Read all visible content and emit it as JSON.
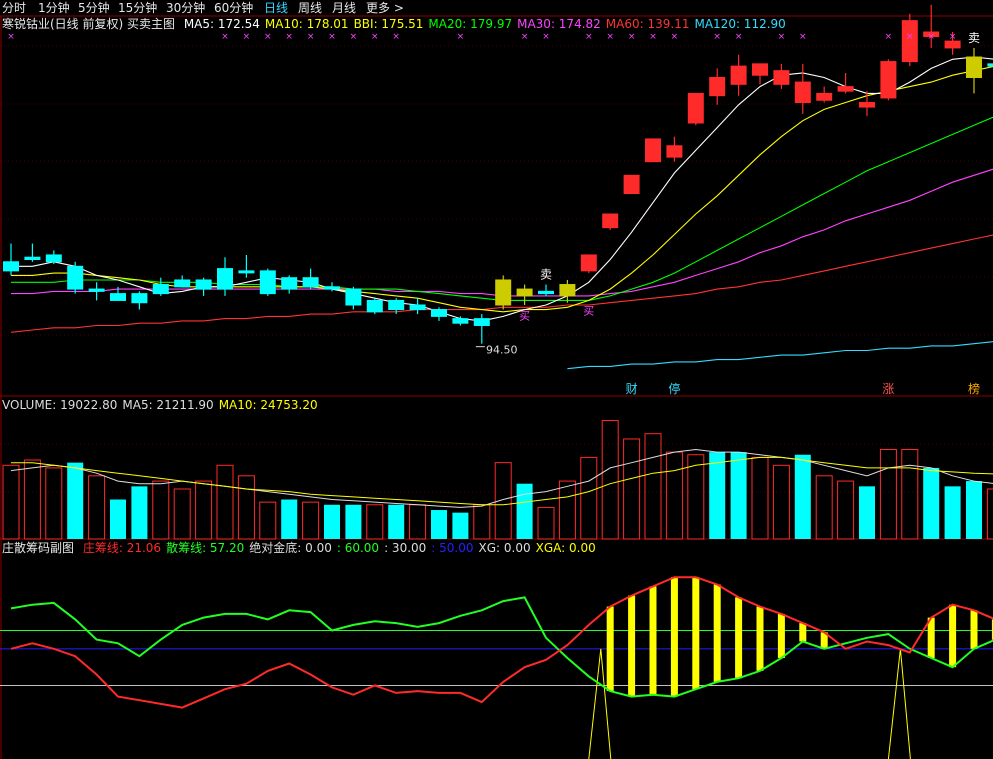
{
  "period_tabs": [
    {
      "label": "分时",
      "active": false
    },
    {
      "label": "1分钟",
      "active": false
    },
    {
      "label": "5分钟",
      "active": false
    },
    {
      "label": "15分钟",
      "active": false
    },
    {
      "label": "30分钟",
      "active": false
    },
    {
      "label": "60分钟",
      "active": false
    },
    {
      "label": "日线",
      "active": true
    },
    {
      "label": "周线",
      "active": false
    },
    {
      "label": "月线",
      "active": false
    },
    {
      "label": "更多 >",
      "active": false
    }
  ],
  "main_legend": {
    "title": "寒锐钴业(日线 前复权) 买卖主图",
    "items": [
      {
        "text": "MA5: 172.54",
        "color": "#ffffff"
      },
      {
        "text": "MA10: 178.01",
        "color": "#ffff00"
      },
      {
        "text": "BBI: 175.51",
        "color": "#ffff00"
      },
      {
        "text": "MA20: 179.97",
        "color": "#00ff00"
      },
      {
        "text": "MA30: 174.82",
        "color": "#ff44ff"
      },
      {
        "text": "MA60: 139.11",
        "color": "#ff3333"
      },
      {
        "text": "MA120: 112.90",
        "color": "#33ddff"
      }
    ]
  },
  "volume_legend": {
    "items": [
      {
        "text": "VOLUME: 19022.80",
        "color": "#dddddd"
      },
      {
        "text": "MA5: 21211.90",
        "color": "#dddddd"
      },
      {
        "text": "MA10: 24753.20",
        "color": "#ffff00"
      }
    ]
  },
  "sub_legend": {
    "title": "庄散筹码副图",
    "items": [
      {
        "text": "庄筹线: 21.06",
        "color": "#ff2a2a"
      },
      {
        "text": "散筹线: 57.20",
        "color": "#22ff22"
      },
      {
        "text": "绝对金底: 0.00",
        "color": "#dddddd"
      },
      {
        "text": ": 60.00",
        "color": "#22ff22"
      },
      {
        "text": ": 30.00",
        "color": "#dddddd"
      },
      {
        "text": ": 50.00",
        "color": "#2222ff"
      },
      {
        "text": "XG: 0.00",
        "color": "#dddddd"
      },
      {
        "text": "XGA: 0.00",
        "color": "#ffff00"
      }
    ]
  },
  "annotations": {
    "low_price": "94.50",
    "sell1": "卖",
    "buy1": "买",
    "buy2": "买",
    "sell2": "卖",
    "event_cai": "财",
    "event_ting": "停",
    "event_zhang": "涨",
    "event_bang": "榜"
  },
  "colors": {
    "up": "#ff2a2a",
    "down": "#00ffff",
    "signal": "#cccc00",
    "ma5": "#ffffff",
    "ma10": "#ffff00",
    "ma20": "#00ff00",
    "ma30": "#ff44ff",
    "ma60": "#ff3333",
    "ma120": "#33ddff",
    "grid": "#8b0000"
  },
  "chart_data": [
    {
      "type": "candlestick",
      "price_range": [
        80,
        240
      ],
      "candles": [
        {
          "o": 139,
          "h": 147,
          "l": 133,
          "c": 135,
          "color": "down"
        },
        {
          "o": 141,
          "h": 147,
          "l": 139,
          "c": 140,
          "color": "down"
        },
        {
          "o": 142,
          "h": 144,
          "l": 138,
          "c": 139,
          "color": "down"
        },
        {
          "o": 137,
          "h": 139,
          "l": 125,
          "c": 127,
          "color": "down"
        },
        {
          "o": 127,
          "h": 130,
          "l": 122,
          "c": 126,
          "color": "down"
        },
        {
          "o": 125,
          "h": 128,
          "l": 122,
          "c": 122,
          "color": "down"
        },
        {
          "o": 125,
          "h": 126,
          "l": 118,
          "c": 121,
          "color": "down"
        },
        {
          "o": 129,
          "h": 132,
          "l": 124,
          "c": 125,
          "color": "down"
        },
        {
          "o": 131,
          "h": 133,
          "l": 128,
          "c": 128,
          "color": "down"
        },
        {
          "o": 127,
          "h": 132,
          "l": 124,
          "c": 131,
          "color": "down"
        },
        {
          "o": 136,
          "h": 141,
          "l": 124,
          "c": 127,
          "color": "down"
        },
        {
          "o": 135,
          "h": 142,
          "l": 132,
          "c": 135,
          "color": "down"
        },
        {
          "o": 135,
          "h": 136,
          "l": 124,
          "c": 125,
          "color": "down"
        },
        {
          "o": 132,
          "h": 133,
          "l": 125,
          "c": 127,
          "color": "down"
        },
        {
          "o": 132,
          "h": 136,
          "l": 127,
          "c": 128,
          "color": "down"
        },
        {
          "o": 128,
          "h": 130,
          "l": 126,
          "c": 127,
          "color": "down"
        },
        {
          "o": 127,
          "h": 128,
          "l": 118,
          "c": 120,
          "color": "down"
        },
        {
          "o": 122,
          "h": 123,
          "l": 116,
          "c": 117,
          "color": "down"
        },
        {
          "o": 122,
          "h": 123,
          "l": 116,
          "c": 118,
          "color": "down"
        },
        {
          "o": 120,
          "h": 123,
          "l": 116,
          "c": 118,
          "color": "down"
        },
        {
          "o": 118,
          "h": 119,
          "l": 113,
          "c": 115,
          "color": "down"
        },
        {
          "o": 114,
          "h": 115,
          "l": 111,
          "c": 112,
          "color": "down"
        },
        {
          "o": 114,
          "h": 116,
          "l": 103,
          "c": 111,
          "color": "down"
        },
        {
          "o": 120,
          "h": 133,
          "l": 118,
          "c": 131,
          "color": "signal"
        },
        {
          "o": 127,
          "h": 129,
          "l": 120,
          "c": 124,
          "color": "signal"
        },
        {
          "o": 126,
          "h": 129,
          "l": 124,
          "c": 125,
          "color": "down"
        },
        {
          "o": 124,
          "h": 131,
          "l": 121,
          "c": 129,
          "color": "signal"
        },
        {
          "o": 135,
          "h": 142,
          "l": 134,
          "c": 142,
          "color": "up"
        },
        {
          "o": 154,
          "h": 160,
          "l": 153,
          "c": 160,
          "color": "up"
        },
        {
          "o": 169,
          "h": 177,
          "l": 169,
          "c": 177,
          "color": "up"
        },
        {
          "o": 183,
          "h": 193,
          "l": 183,
          "c": 193,
          "color": "up"
        },
        {
          "o": 190,
          "h": 194,
          "l": 183,
          "c": 185,
          "color": "up"
        },
        {
          "o": 200,
          "h": 213,
          "l": 199,
          "c": 213,
          "color": "up"
        },
        {
          "o": 212,
          "h": 224,
          "l": 208,
          "c": 220,
          "color": "up"
        },
        {
          "o": 217,
          "h": 230,
          "l": 212,
          "c": 225,
          "color": "up"
        },
        {
          "o": 226,
          "h": 226,
          "l": 217,
          "c": 221,
          "color": "up"
        },
        {
          "o": 223,
          "h": 226,
          "l": 215,
          "c": 217,
          "color": "up"
        },
        {
          "o": 218,
          "h": 226,
          "l": 204,
          "c": 209,
          "color": "up"
        },
        {
          "o": 213,
          "h": 216,
          "l": 209,
          "c": 210,
          "color": "up"
        },
        {
          "o": 216,
          "h": 222,
          "l": 213,
          "c": 214,
          "color": "up"
        },
        {
          "o": 209,
          "h": 214,
          "l": 203,
          "c": 207,
          "color": "up"
        },
        {
          "o": 211,
          "h": 228,
          "l": 210,
          "c": 227,
          "color": "up"
        },
        {
          "o": 245,
          "h": 248,
          "l": 225,
          "c": 227,
          "color": "up"
        },
        {
          "o": 240,
          "h": 252,
          "l": 233,
          "c": 238,
          "color": "up"
        },
        {
          "o": 233,
          "h": 240,
          "l": 230,
          "c": 236,
          "color": "up"
        },
        {
          "o": 220,
          "h": 233,
          "l": 213,
          "c": 229,
          "color": "signal"
        },
        {
          "o": 226,
          "h": 228,
          "l": 223,
          "c": 225,
          "color": "down"
        }
      ],
      "ma5": [
        137,
        137,
        139,
        137,
        133,
        131,
        128,
        125,
        126,
        128,
        128,
        130,
        132,
        131,
        130,
        127,
        125,
        123,
        121,
        120,
        117,
        114,
        113,
        115,
        118,
        120,
        124,
        130,
        140,
        152,
        165,
        178,
        188,
        198,
        208,
        216,
        221,
        222,
        220,
        216,
        213,
        213,
        218,
        224,
        228,
        229,
        228
      ],
      "ma10": [
        133,
        133,
        134,
        134,
        133,
        132,
        131,
        129,
        128,
        128,
        128,
        128,
        128,
        128,
        128,
        127,
        126,
        125,
        124,
        123,
        121,
        119,
        118,
        117,
        118,
        118,
        119,
        122,
        127,
        134,
        142,
        151,
        160,
        168,
        177,
        186,
        194,
        201,
        206,
        209,
        212,
        214,
        216,
        218,
        221,
        223,
        225
      ],
      "ma20": [
        130,
        130,
        130,
        131,
        131,
        131,
        131,
        130,
        130,
        130,
        129,
        129,
        129,
        128,
        128,
        128,
        127,
        127,
        127,
        126,
        125,
        124,
        123,
        122,
        122,
        122,
        122,
        122,
        124,
        127,
        130,
        134,
        139,
        144,
        149,
        154,
        159,
        164,
        169,
        174,
        179,
        183,
        187,
        191,
        195,
        199,
        203
      ],
      "ma30": [
        125,
        125,
        126,
        126,
        126,
        127,
        127,
        127,
        127,
        127,
        127,
        127,
        127,
        127,
        127,
        127,
        127,
        127,
        126,
        126,
        126,
        125,
        125,
        124,
        124,
        124,
        124,
        124,
        125,
        126,
        128,
        130,
        133,
        136,
        139,
        143,
        146,
        150,
        153,
        157,
        160,
        163,
        166,
        170,
        174,
        177,
        180
      ],
      "ma60": [
        108,
        109,
        110,
        110,
        111,
        111,
        112,
        112,
        113,
        113,
        114,
        114,
        115,
        115,
        116,
        116,
        117,
        117,
        117,
        118,
        118,
        118,
        118,
        119,
        119,
        119,
        120,
        120,
        121,
        122,
        123,
        124,
        125,
        127,
        128,
        130,
        131,
        133,
        135,
        137,
        139,
        141,
        143,
        145,
        147,
        149,
        151
      ],
      "ma120_start_index": 26,
      "ma120": [
        92,
        93,
        93,
        94,
        94,
        95,
        95,
        96,
        96,
        97,
        98,
        98,
        99,
        100,
        100,
        101,
        101,
        102,
        102,
        103,
        104
      ],
      "price_labels": {
        "low": 94.5
      }
    },
    {
      "type": "bar",
      "title": "VOLUME",
      "range": [
        0,
        49000
      ],
      "values": [
        {
          "v": 28000,
          "color": "up"
        },
        {
          "v": 30000,
          "color": "up"
        },
        {
          "v": 27000,
          "color": "up"
        },
        {
          "v": 29000,
          "color": "down"
        },
        {
          "v": 24000,
          "color": "up"
        },
        {
          "v": 15000,
          "color": "down"
        },
        {
          "v": 20000,
          "color": "down"
        },
        {
          "v": 22000,
          "color": "up"
        },
        {
          "v": 19000,
          "color": "up"
        },
        {
          "v": 22000,
          "color": "up"
        },
        {
          "v": 28000,
          "color": "up"
        },
        {
          "v": 24000,
          "color": "up"
        },
        {
          "v": 14000,
          "color": "up"
        },
        {
          "v": 15000,
          "color": "down"
        },
        {
          "v": 14000,
          "color": "up"
        },
        {
          "v": 13000,
          "color": "down"
        },
        {
          "v": 13000,
          "color": "down"
        },
        {
          "v": 13000,
          "color": "up"
        },
        {
          "v": 13000,
          "color": "down"
        },
        {
          "v": 13000,
          "color": "up"
        },
        {
          "v": 11000,
          "color": "down"
        },
        {
          "v": 10000,
          "color": "down"
        },
        {
          "v": 13000,
          "color": "up"
        },
        {
          "v": 29000,
          "color": "up"
        },
        {
          "v": 21000,
          "color": "down"
        },
        {
          "v": 12000,
          "color": "up"
        },
        {
          "v": 22000,
          "color": "up"
        },
        {
          "v": 31000,
          "color": "up"
        },
        {
          "v": 45000,
          "color": "up"
        },
        {
          "v": 38000,
          "color": "up"
        },
        {
          "v": 40000,
          "color": "up"
        },
        {
          "v": 33000,
          "color": "up"
        },
        {
          "v": 32000,
          "color": "up"
        },
        {
          "v": 33000,
          "color": "down"
        },
        {
          "v": 33000,
          "color": "down"
        },
        {
          "v": 31000,
          "color": "up"
        },
        {
          "v": 28000,
          "color": "up"
        },
        {
          "v": 32000,
          "color": "down"
        },
        {
          "v": 24000,
          "color": "up"
        },
        {
          "v": 22000,
          "color": "up"
        },
        {
          "v": 20000,
          "color": "down"
        },
        {
          "v": 34000,
          "color": "up"
        },
        {
          "v": 34000,
          "color": "up"
        },
        {
          "v": 27000,
          "color": "down"
        },
        {
          "v": 20000,
          "color": "down"
        },
        {
          "v": 22000,
          "color": "down"
        },
        {
          "v": 19000,
          "color": "up"
        }
      ],
      "ma5": [
        26000,
        27000,
        28000,
        27000,
        25000,
        22000,
        21000,
        21000,
        22000,
        21000,
        20000,
        19000,
        18000,
        17000,
        16000,
        15000,
        14500,
        14000,
        13500,
        13000,
        12500,
        12000,
        12500,
        15000,
        17000,
        18000,
        20000,
        22000,
        27000,
        29000,
        31000,
        33000,
        34000,
        33000,
        33000,
        32000,
        31000,
        30000,
        28000,
        26000,
        24000,
        27000,
        28000,
        27000,
        24000,
        22000,
        21000
      ],
      "ma10": [
        29000,
        29000,
        28000,
        27000,
        26000,
        25000,
        24000,
        23000,
        22000,
        21000,
        20000,
        19000,
        18500,
        18000,
        17000,
        16500,
        16000,
        15500,
        15000,
        14500,
        14000,
        13500,
        13000,
        13000,
        14000,
        15000,
        16000,
        18000,
        21000,
        23000,
        25000,
        26000,
        28000,
        29000,
        30000,
        31000,
        31000,
        30000,
        29000,
        28000,
        27000,
        27000,
        27000,
        26000,
        25500,
        25000,
        24700
      ]
    },
    {
      "type": "line",
      "title": "庄散筹码副图",
      "range": [
        -10,
        100
      ],
      "reference_levels": [
        60,
        30,
        50
      ],
      "series": [
        {
          "name": "庄筹线",
          "color": "#ff2a2a",
          "values": [
            50,
            53,
            50,
            46,
            36,
            24,
            22,
            20,
            18,
            23,
            28,
            31,
            38,
            42,
            36,
            29,
            25,
            30,
            26,
            27,
            26,
            26,
            21,
            32,
            40,
            44,
            52,
            63,
            73,
            79,
            84,
            89,
            89,
            85,
            78,
            73,
            69,
            64,
            59,
            50,
            54,
            52,
            48,
            67,
            74,
            71,
            66
          ]
        },
        {
          "name": "散筹线",
          "color": "#22ff22",
          "values": [
            72,
            74,
            75,
            66,
            55,
            53,
            46,
            55,
            63,
            67,
            69,
            69,
            66,
            71,
            70,
            60,
            63,
            65,
            64,
            62,
            64,
            68,
            71,
            76,
            78,
            56,
            45,
            35,
            27,
            24,
            25,
            24,
            28,
            32,
            34,
            38,
            45,
            54,
            50,
            53,
            56,
            58,
            50,
            45,
            40,
            50,
            55
          ]
        },
        {
          "name": "XGA",
          "color": "#ffff00",
          "type": "bar",
          "values": [
            0,
            0,
            0,
            0,
            0,
            0,
            0,
            0,
            0,
            0,
            0,
            0,
            0,
            0,
            0,
            0,
            0,
            0,
            0,
            0,
            0,
            0,
            0,
            0,
            0,
            0,
            0,
            0,
            59,
            62,
            64,
            63,
            62,
            61,
            59,
            50,
            50,
            47,
            4,
            0,
            0,
            0,
            0,
            33,
            40,
            35,
            2
          ]
        }
      ]
    }
  ]
}
